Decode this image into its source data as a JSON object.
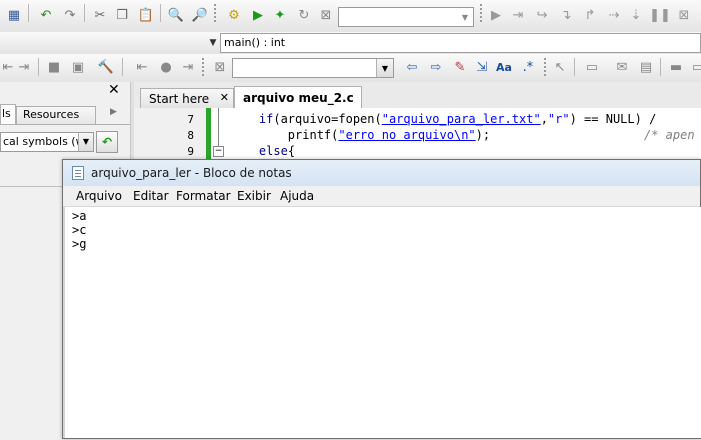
{
  "toolbar": {
    "combo_blank_value": "",
    "scope_value": "main() : int",
    "search_value": ""
  },
  "left_panel": {
    "tabs": [
      "ls",
      "Resources"
    ],
    "symbols_filter": "cal symbols (wor"
  },
  "editor": {
    "tabs": [
      "Start here",
      "arquivo meu_2.c"
    ],
    "line_numbers": [
      "7",
      "8",
      "9"
    ],
    "lines": {
      "l7_indent": "    ",
      "l7_if": "if",
      "l7_a": "(arquivo=fopen(",
      "l7_s1": "\"arquivo_para_ler.txt\"",
      "l7_b": ",",
      "l7_s2": "\"r\"",
      "l7_c": ") == NULL) /",
      "l8_indent": "        ",
      "l8_printf": "printf(",
      "l8_s": "\"erro no arquivo\\n\"",
      "l8_end": ");",
      "l8_comment": "/* apen",
      "l9_indent": "    ",
      "l9_else": "else",
      "l9_brace": "{"
    }
  },
  "notepad": {
    "title": "arquivo_para_ler - Bloco de notas",
    "menu": [
      "Arquivo",
      "Editar",
      "Formatar",
      "Exibir",
      "Ajuda"
    ],
    "content_lines": [
      ">a",
      ">c",
      ">g"
    ]
  },
  "colors": {
    "accent_green": "#2aa52a",
    "string_blue": "#0000ff",
    "titlebar": "#dbe8f5"
  }
}
